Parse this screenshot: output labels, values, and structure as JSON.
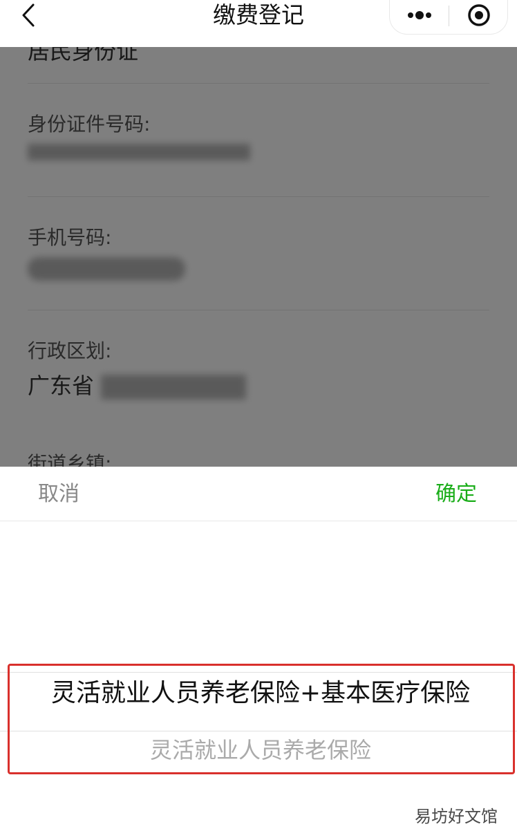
{
  "nav": {
    "title": "缴费登记"
  },
  "form": {
    "partial_value": "居民身份证",
    "id_number_label": "身份证件号码:",
    "phone_label": "手机号码:",
    "region_label": "行政区划:",
    "region_value": "广东省",
    "street_label": "街道乡镇:"
  },
  "picker": {
    "cancel_label": "取消",
    "confirm_label": "确定",
    "confirm_color": "#1aad19",
    "options": [
      "灵活就业人员养老保险+基本医疗保险",
      "灵活就业人员养老保险"
    ],
    "highlight_color": "#d9302c"
  },
  "watermark": "易坊好文馆"
}
